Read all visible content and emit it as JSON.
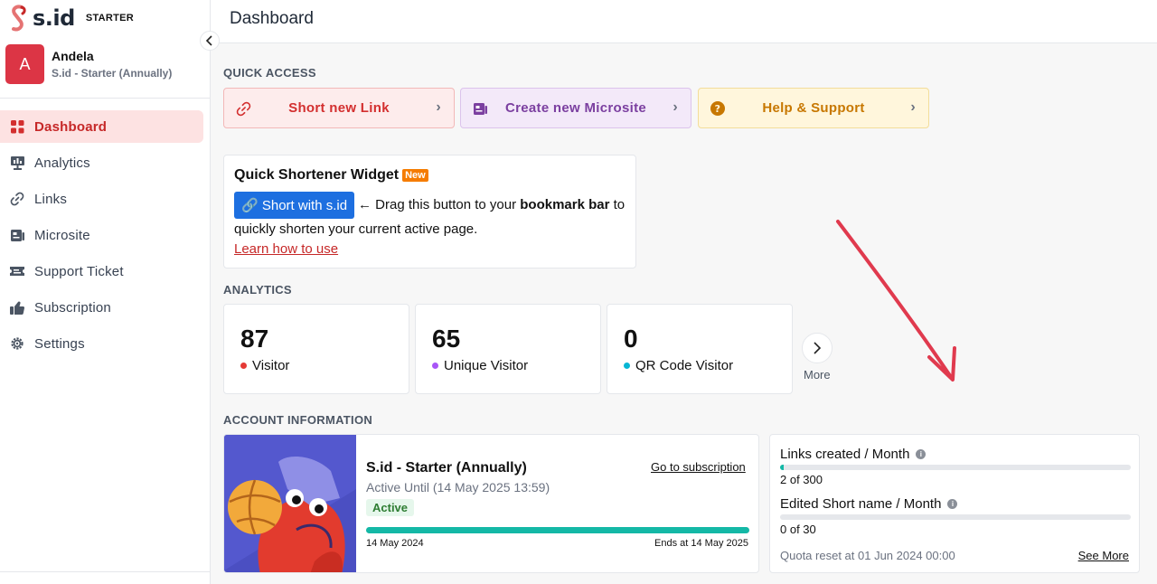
{
  "brand": {
    "name": "s.id",
    "tier": "STARTER"
  },
  "user": {
    "initial": "A",
    "name": "Andela",
    "plan": "S.id - Starter (Annually)"
  },
  "nav": [
    {
      "label": "Dashboard",
      "icon": "dashboard-icon",
      "active": true
    },
    {
      "label": "Analytics",
      "icon": "analytics-icon"
    },
    {
      "label": "Links",
      "icon": "link-icon"
    },
    {
      "label": "Microsite",
      "icon": "microsite-icon"
    },
    {
      "label": "Support Ticket",
      "icon": "ticket-icon"
    },
    {
      "label": "Subscription",
      "icon": "thumbs-up-icon"
    },
    {
      "label": "Settings",
      "icon": "gear-icon"
    }
  ],
  "header": {
    "title": "Dashboard"
  },
  "quick_access": {
    "label": "QUICK ACCESS",
    "items": [
      {
        "label": "Short new Link",
        "icon": "link-icon",
        "color": "#d32f2f",
        "bg": "#fdecec"
      },
      {
        "label": "Create new Microsite",
        "icon": "microsite-icon",
        "color": "#7b3fa0",
        "bg": "#f3e9f9"
      },
      {
        "label": "Help & Support",
        "icon": "help-icon",
        "color": "#c77700",
        "bg": "#fff6dc"
      }
    ]
  },
  "widget": {
    "title": "Quick Shortener Widget",
    "badge": "New",
    "button": "🔗 Short with s.id",
    "text_before": "← Drag this button to your ",
    "text_bold": "bookmark bar",
    "text_after": " to",
    "text_line2": "quickly shorten your current active page.",
    "learn_link": "Learn how to use"
  },
  "analytics": {
    "label": "ANALYTICS",
    "stats": [
      {
        "value": "87",
        "label": "Visitor",
        "color": "#e53935"
      },
      {
        "value": "65",
        "label": "Unique Visitor",
        "color": "#a855f7"
      },
      {
        "value": "0",
        "label": "QR Code Visitor",
        "color": "#06b6d4"
      }
    ],
    "more": "More"
  },
  "account": {
    "label": "ACCOUNT INFORMATION",
    "plan": "S.id - Starter (Annually)",
    "goto": "Go to subscription",
    "active_until": "Active Until (14 May 2025 13:59)",
    "status": "Active",
    "start": "14 May 2024",
    "end": "Ends at 14 May 2025",
    "progress_percent": 100
  },
  "quota": {
    "links": {
      "label": "Links created / Month",
      "count": "2 of 300",
      "percent": 0.67
    },
    "edited": {
      "label": "Edited Short name / Month",
      "count": "0 of 30",
      "percent": 0
    },
    "reset": "Quota reset at 01 Jun 2024 00:00",
    "see_more": "See More"
  }
}
